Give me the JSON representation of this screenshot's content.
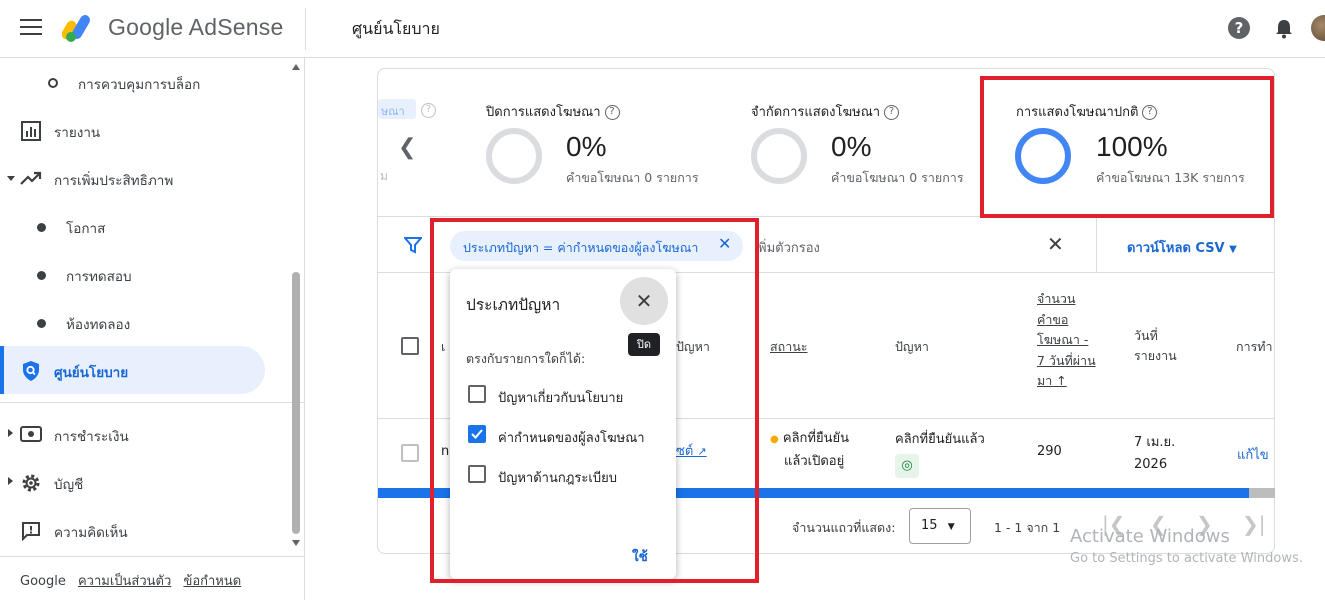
{
  "header": {
    "brand": "Google AdSense",
    "page_title": "ศูนย์นโยบาย",
    "help": "?"
  },
  "sidebar": {
    "items": [
      {
        "label": "การควบคุมการบล็อก"
      },
      {
        "label": "รายงาน"
      },
      {
        "label": "การเพิ่มประสิทธิภาพ"
      },
      {
        "label": "โอกาส"
      },
      {
        "label": "การทดสอบ"
      },
      {
        "label": "ห้องทดลอง"
      },
      {
        "label": "ศูนย์นโยบาย"
      },
      {
        "label": "การชำระเงิน"
      },
      {
        "label": "บัญชี"
      },
      {
        "label": "ความคิดเห็น"
      }
    ],
    "footer": {
      "google": "Google",
      "privacy": "ความเป็นส่วนตัว",
      "terms": "ข้อกำหนด"
    }
  },
  "stats": {
    "partial_label": "ษณา",
    "partial_sub": "ม",
    "cards": [
      {
        "title": "ปิดการแสดงโฆษณา",
        "percent": "0%",
        "sub": "คำขอโฆษณา 0 รายการ",
        "fill": 0
      },
      {
        "title": "จำกัดการแสดงโฆษณา",
        "percent": "0%",
        "sub": "คำขอโฆษณา 0 รายการ",
        "fill": 0
      },
      {
        "title": "การแสดงโฆษณาปกติ",
        "percent": "100%",
        "sub": "คำขอโฆษณา 13K รายการ",
        "fill": 1
      }
    ]
  },
  "filter": {
    "chip": "ประเภทปัญหา = ค่ากำหนดของผู้ลงโฆษณา",
    "add_filter": "พิ่มตัวกรอง",
    "download": "ดาวน์โหลด CSV"
  },
  "table": {
    "headers": {
      "col1": "เ",
      "issue_type": "ปัญหา",
      "status": "สถานะ",
      "problem": "ปัญหา",
      "requests": [
        "จำนวน",
        "คำขอ",
        "โฆษณา -",
        "7 วันที่ผ่าน",
        "มา ↑"
      ],
      "date": [
        "วันที่",
        "รายงาน"
      ],
      "action": "การทำ"
    },
    "rows": [
      {
        "col1": "n",
        "issue_link": "ซต์",
        "status": [
          "คลิกที่ยืนยัน",
          "แล้วเปิดอยู่"
        ],
        "problem": "คลิกที่ยืนยันแล้ว",
        "requests": "290",
        "date": [
          "7 เม.ย.",
          "2026"
        ],
        "action": "แก้ไข"
      }
    ]
  },
  "pagination": {
    "rows_label": "จำนวนแถวที่แสดง:",
    "rows_value": "15",
    "range": "1 - 1 จาก 1"
  },
  "popup": {
    "title": "ประเภทปัญหา",
    "tooltip": "ปิด",
    "subtitle": "ตรงกับรายการใดก็ได้:",
    "options": [
      {
        "label": "ปัญหาเกี่ยวกับนโยบาย",
        "checked": false
      },
      {
        "label": "ค่ากำหนดของผู้ลงโฆษณา",
        "checked": true
      },
      {
        "label": "ปัญหาด้านกฎระเบียบ",
        "checked": false
      }
    ],
    "apply": "ใช้"
  },
  "watermark": {
    "line1": "Activate Windows",
    "line2": "Go to Settings to activate Windows."
  },
  "colors": {
    "accent": "#1a73e8",
    "highlight_box": "#e0202a",
    "status_dot": "#f9ab00"
  }
}
